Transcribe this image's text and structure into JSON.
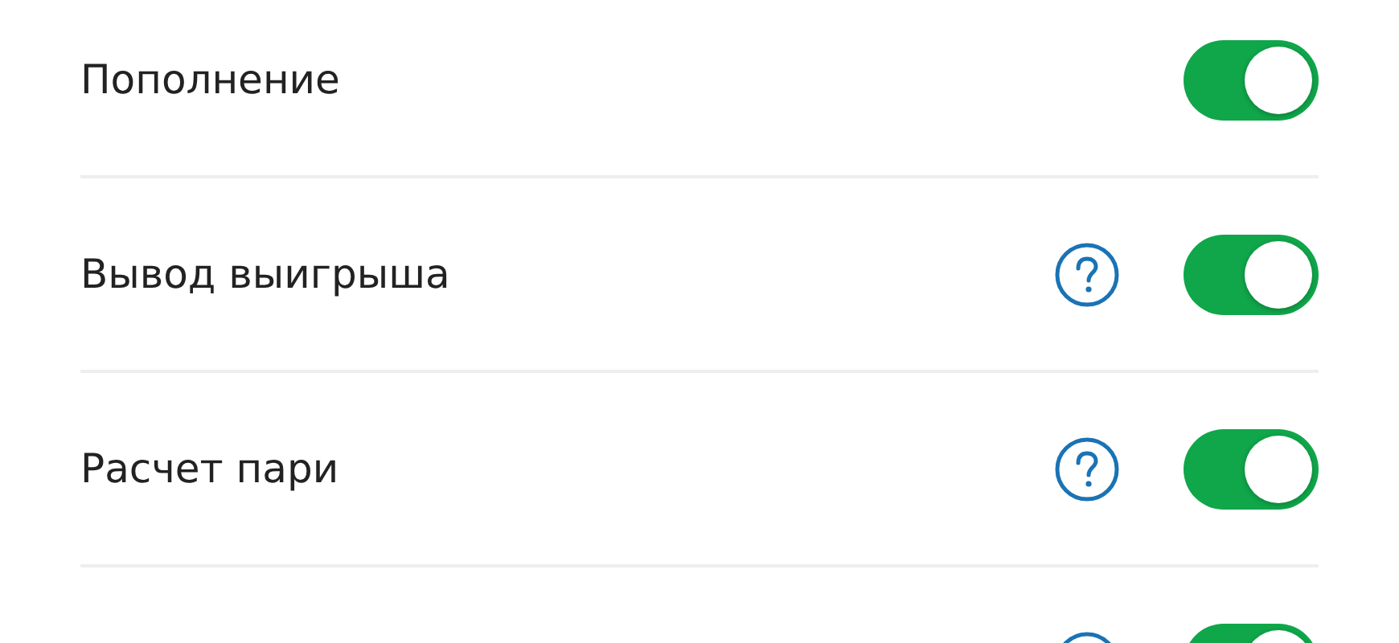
{
  "settings": [
    {
      "label": "Пополнение",
      "help": false,
      "on": true
    },
    {
      "label": "Вывод выигрыша",
      "help": true,
      "on": true
    },
    {
      "label": "Расчет пари",
      "help": true,
      "on": true
    },
    {
      "help": true,
      "on": true
    }
  ]
}
